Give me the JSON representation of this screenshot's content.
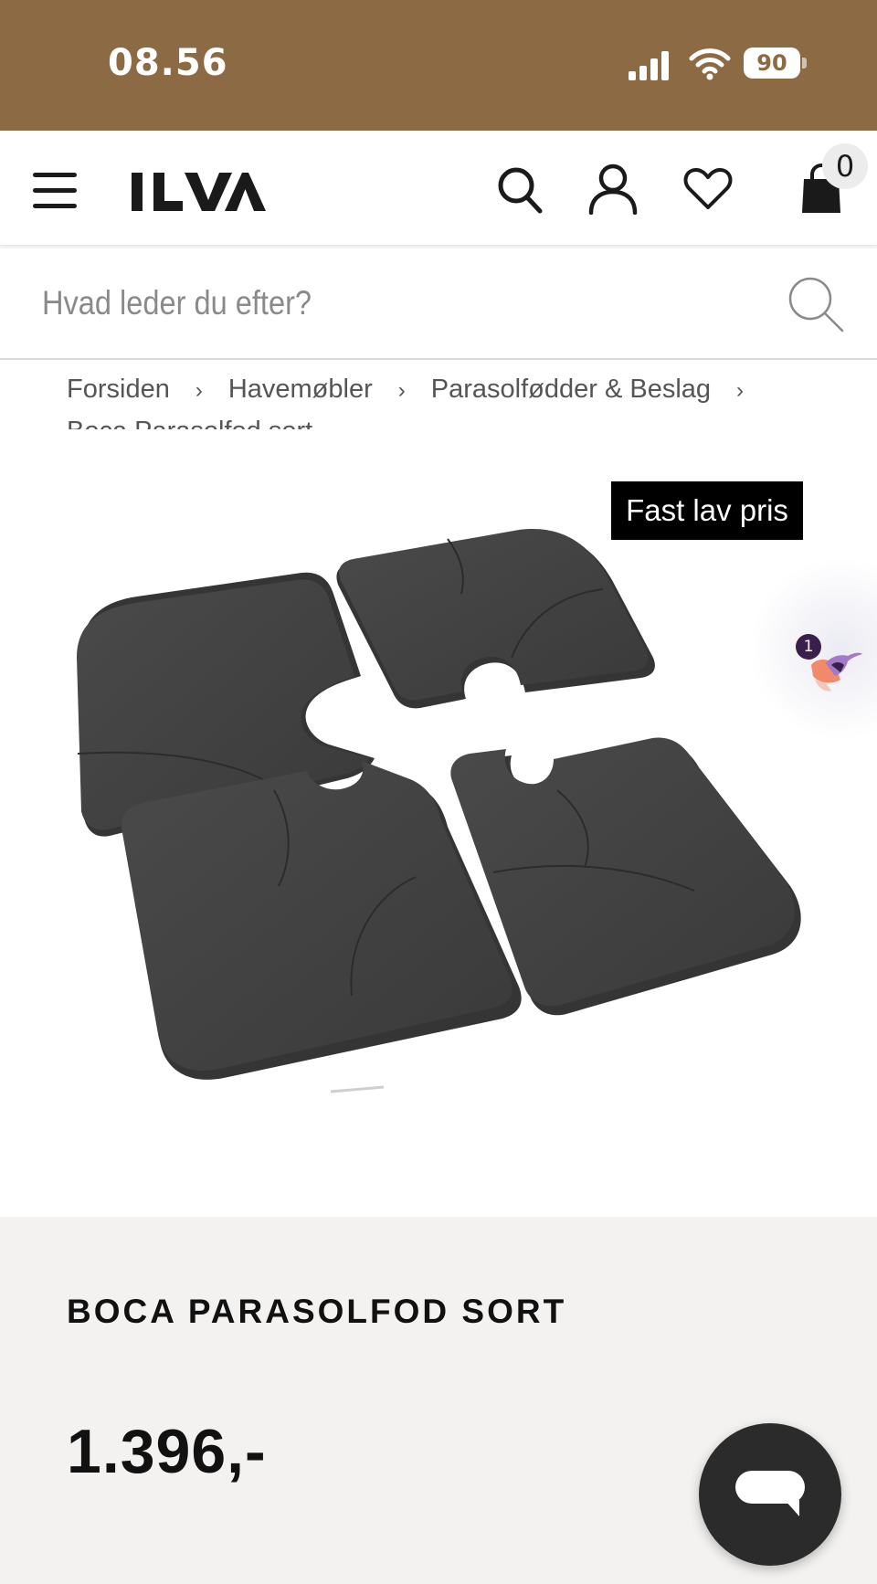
{
  "status_bar": {
    "time": "08.56",
    "battery": "90",
    "icons": [
      "cellular-signal-icon",
      "wifi-icon",
      "battery-icon"
    ],
    "background": "#8c6a44"
  },
  "header": {
    "logo_text": "ILVA",
    "icons": [
      "menu-icon",
      "search-icon",
      "account-icon",
      "heart-icon",
      "shopping-bag-icon"
    ],
    "cart_count": "0"
  },
  "search": {
    "placeholder": "Hvad leder du efter?"
  },
  "breadcrumb": {
    "items": [
      "Forsiden",
      "Havemøbler",
      "Parasolfødder & Beslag"
    ],
    "current": "Boca Parasolfod sort",
    "separator": "›"
  },
  "product": {
    "badge": "Fast lav pris",
    "notification_count": "1",
    "brand": "BOCA",
    "name": "PARASOLFOD SORT",
    "price": "1.396,-"
  },
  "colors": {
    "accent_green": "#2b6c5a",
    "info_background": "#f3f2f0",
    "badge_background": "#000000"
  }
}
